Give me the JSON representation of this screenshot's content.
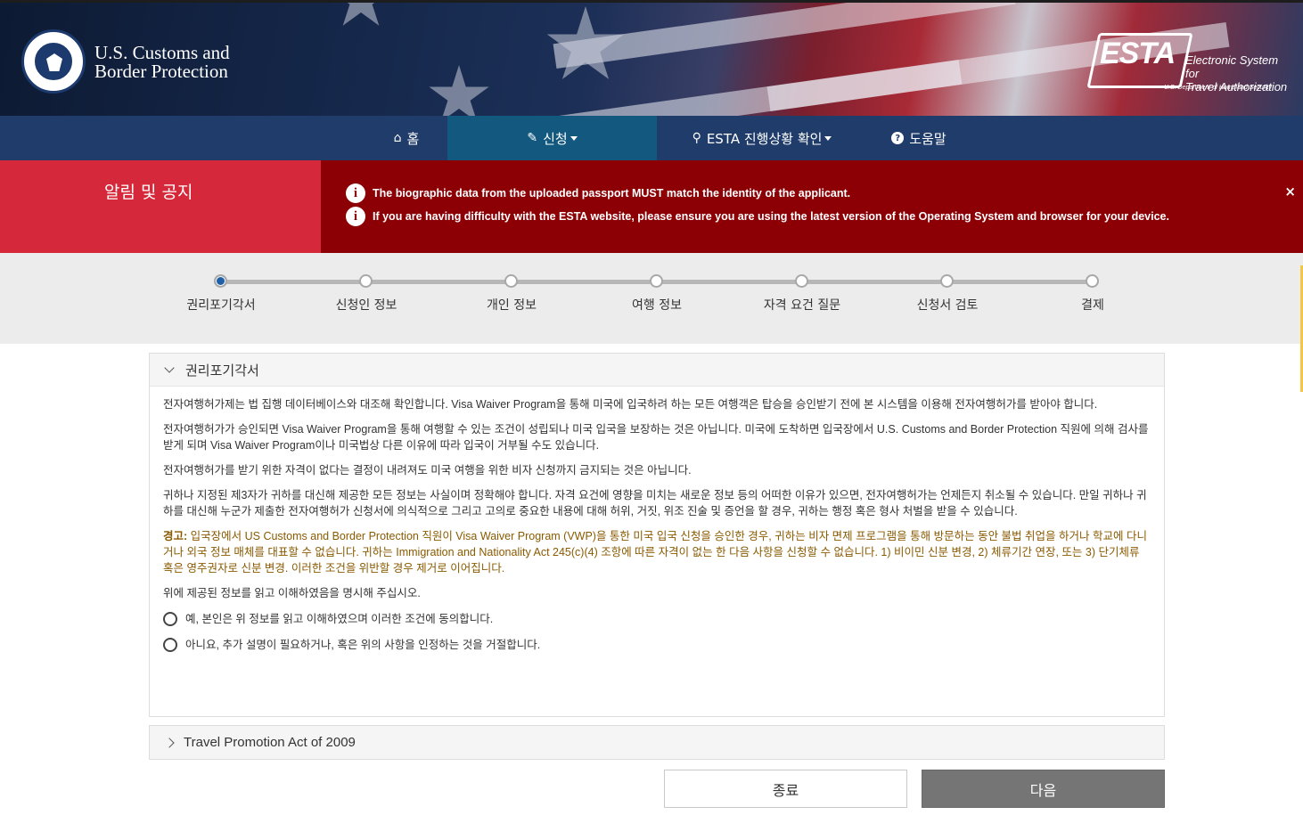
{
  "header": {
    "agency_line1": "U.S. Customs and",
    "agency_line2": "Border Protection",
    "seal_text": "U.S. DEPARTMENT OF HOMELAND SECURITY",
    "esta_logo": "ESTA",
    "esta_sub_line1": "Electronic System for",
    "esta_sub_line2": "Travel Authorization",
    "esta_dept": "U.S. Department of Homeland Security"
  },
  "nav": {
    "home": {
      "label": "홈",
      "icon": "home-icon"
    },
    "apply": {
      "label": "신청",
      "icon": "pencil-icon"
    },
    "status": {
      "label": "ESTA 진행상황 확인",
      "icon": "search-icon"
    },
    "help": {
      "label": "도움말",
      "icon": "question-circle-icon"
    }
  },
  "alert": {
    "title": "알림 및 공지",
    "messages": [
      "The biographic data from the uploaded passport MUST match the identity of the applicant.",
      "If you are having difficulty with the ESTA website, please ensure you are using the latest version of the Operating System and browser for your device."
    ],
    "close": "×"
  },
  "progress": {
    "current_index": 0,
    "steps": [
      "권리포기각서",
      "신청인 정보",
      "개인 정보",
      "여행 정보",
      "자격 요건 질문",
      "신청서 검토",
      "결제"
    ]
  },
  "waiver": {
    "heading": "권리포기각서",
    "p1": "전자여행허가제는 법 집행 데이터베이스와 대조해 확인합니다. Visa Waiver Program을 통해 미국에 입국하려 하는 모든 여행객은 탑승을 승인받기 전에 본 시스템을 이용해 전자여행허가를 받아야 합니다.",
    "p2": "전자여행허가가 승인되면 Visa Waiver Program을 통해 여행할 수 있는 조건이 성립되나 미국 입국을 보장하는 것은 아닙니다. 미국에 도착하면 입국장에서 U.S. Customs and Border Protection 직원에 의해 검사를 받게 되며 Visa Waiver Program이나 미국법상 다른 이유에 따라 입국이 거부될 수도 있습니다.",
    "p3": "전자여행허가를 받기 위한 자격이 없다는 결정이 내려져도 미국 여행을 위한 비자 신청까지 금지되는 것은 아닙니다.",
    "p4": "귀하나 지정된 제3자가 귀하를 대신해 제공한 모든 정보는 사실이며 정확해야 합니다. 자격 요건에 영향을 미치는 새로운 정보 등의 어떠한 이유가 있으면, 전자여행허가는 언제든지 취소될 수 있습니다. 만일 귀하나 귀하를 대신해 누군가 제출한 전자여행허가 신청서에 의식적으로 그리고 고의로 중요한 내용에 대해 허위, 거짓, 위조 진술 및 증언을 할 경우, 귀하는 행정 혹은 형사 처벌을 받을 수 있습니다.",
    "warning_label": "경고:",
    "warning_text": " 입국장에서 US Customs and Border Protection 직원이 Visa Waiver Program (VWP)을 통한 미국 입국 신청을 승인한 경우, 귀하는 비자 면제 프로그램을 통해 방문하는 동안 불법 취업을 하거나 학교에 다니거나 외국 정보 매체를 대표할 수 없습니다. 귀하는 Immigration and Nationality Act 245(c)(4) 조항에 따른 자격이 없는 한 다음 사항을 신청할 수 없습니다. 1) 비이민 신분 변경, 2) 체류기간 연장, 또는 3) 단기체류 혹은 영주권자로 신분 변경. 이러한 조건을 위반할 경우 제거로 이어집니다.",
    "confirm_prompt": "위에 제공된 정보를 읽고 이해하였음을 명시해 주십시오.",
    "option_yes": "예, 본인은 위 정보를 읽고 이해하였으며 이러한 조건에 동의합니다.",
    "option_no": "아니요, 추가 설명이 필요하거나, 혹은 위의 사항을 인정하는 것을 거절합니다."
  },
  "travel_promotion": {
    "heading": "Travel Promotion Act of 2009"
  },
  "buttons": {
    "exit": "종료",
    "next": "다음"
  },
  "colors": {
    "nav_bg": "#1f3c6b",
    "nav_active": "#12587f",
    "alert_title_bg": "#d5283a",
    "alert_bg": "#8c0005",
    "progress_current": "#1f5fa8",
    "warning_text": "#8a5a00",
    "next_button": "#757575"
  }
}
